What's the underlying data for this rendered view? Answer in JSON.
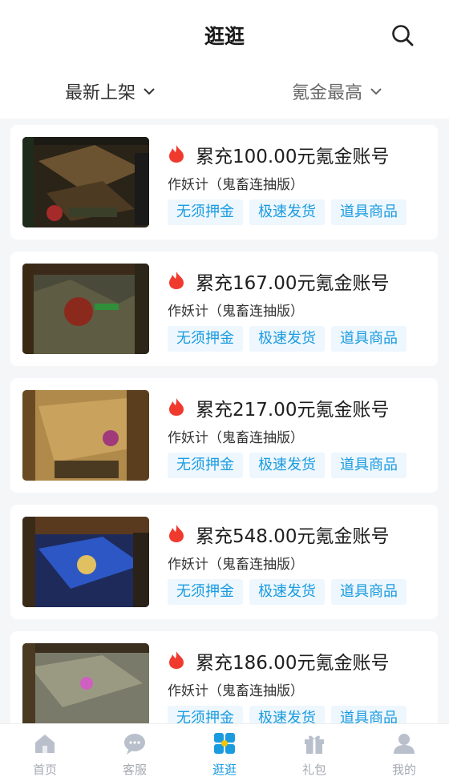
{
  "header": {
    "title": "逛逛"
  },
  "filters": {
    "sort_new": "最新上架",
    "sort_price": "氪金最高"
  },
  "colors": {
    "accent": "#1a9be0",
    "tag_bg": "#eef7fd",
    "flame": "#f03a2e"
  },
  "listings": [
    {
      "title": "累充100.00元氪金账号",
      "subtitle": "作妖计（鬼畜连抽版）",
      "tags": [
        "无须押金",
        "极速发货",
        "道具商品"
      ]
    },
    {
      "title": "累充167.00元氪金账号",
      "subtitle": "作妖计（鬼畜连抽版）",
      "tags": [
        "无须押金",
        "极速发货",
        "道具商品"
      ]
    },
    {
      "title": "累充217.00元氪金账号",
      "subtitle": "作妖计（鬼畜连抽版）",
      "tags": [
        "无须押金",
        "极速发货",
        "道具商品"
      ]
    },
    {
      "title": "累充548.00元氪金账号",
      "subtitle": "作妖计（鬼畜连抽版）",
      "tags": [
        "无须押金",
        "极速发货",
        "道具商品"
      ]
    },
    {
      "title": "累充186.00元氪金账号",
      "subtitle": "作妖计（鬼畜连抽版）",
      "tags": [
        "无须押金",
        "极速发货",
        "道具商品"
      ]
    }
  ],
  "tabbar": [
    {
      "label": "首页",
      "icon": "home-icon"
    },
    {
      "label": "客服",
      "icon": "chat-icon"
    },
    {
      "label": "逛逛",
      "icon": "browse-icon",
      "active": true
    },
    {
      "label": "礼包",
      "icon": "gift-icon"
    },
    {
      "label": "我的",
      "icon": "user-icon"
    }
  ]
}
